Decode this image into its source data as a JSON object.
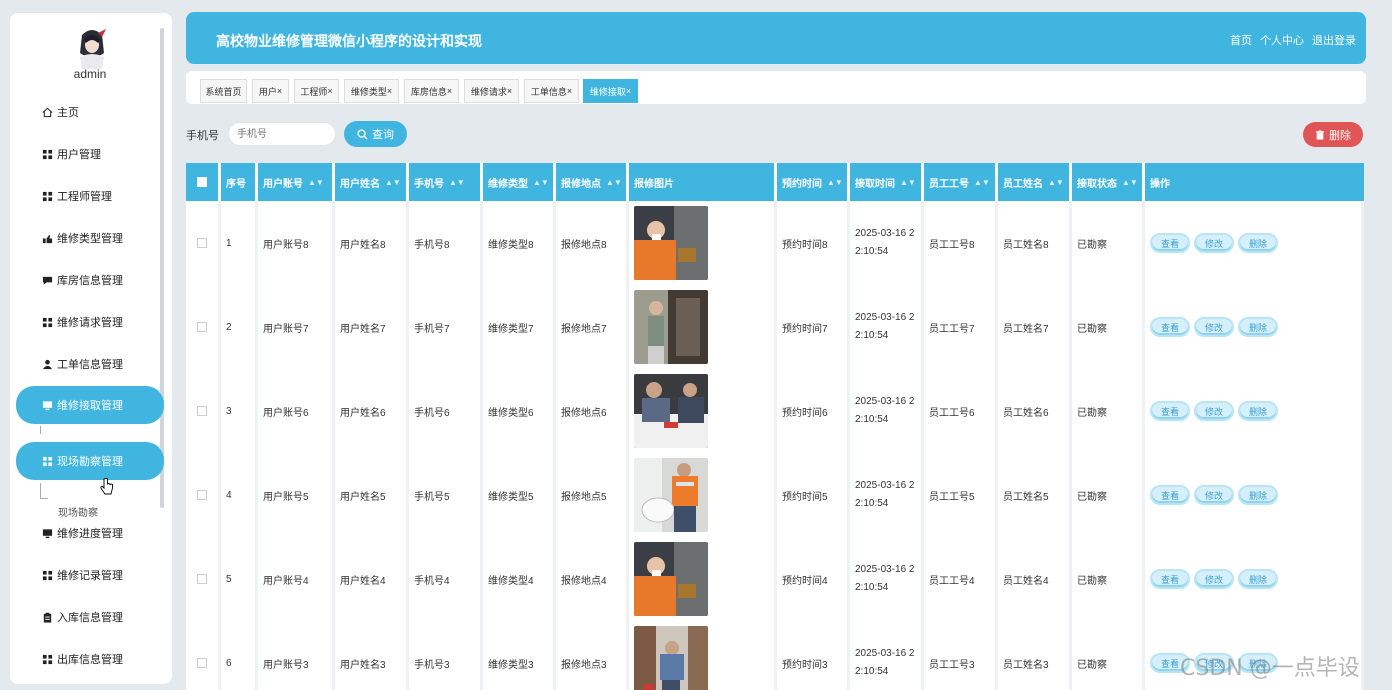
{
  "sidebar": {
    "username": "admin",
    "items": [
      {
        "label": "主页",
        "icon": "home-icon"
      },
      {
        "label": "用户管理",
        "icon": "grid-icon"
      },
      {
        "label": "工程师管理",
        "icon": "grid-icon"
      },
      {
        "label": "维修类型管理",
        "icon": "hand-icon"
      },
      {
        "label": "库房信息管理",
        "icon": "chat-icon"
      },
      {
        "label": "维修请求管理",
        "icon": "grid-icon"
      },
      {
        "label": "工单信息管理",
        "icon": "user-icon"
      },
      {
        "label": "维修接取管理",
        "icon": "monitor-icon"
      },
      {
        "label": "现场勘察管理",
        "icon": "grid-icon"
      },
      {
        "label": "维修进度管理",
        "icon": "monitor-icon"
      },
      {
        "label": "维修记录管理",
        "icon": "grid-icon"
      },
      {
        "label": "入库信息管理",
        "icon": "clipboard-icon"
      },
      {
        "label": "出库信息管理",
        "icon": "grid-icon"
      }
    ],
    "submenu_label": "现场勘察"
  },
  "header": {
    "title": "高校物业维修管理微信小程序的设计和实现",
    "links": [
      "首页",
      "个人中心",
      "退出登录"
    ]
  },
  "tabs": [
    "系统首页",
    "用户",
    "工程师",
    "维修类型",
    "库房信息",
    "维修请求",
    "工单信息",
    "维修接取"
  ],
  "search": {
    "label": "手机号",
    "placeholder": "手机号",
    "button": "查询",
    "delete_button": "删除"
  },
  "table": {
    "columns": [
      "序号",
      "用户账号",
      "用户姓名",
      "手机号",
      "维修类型",
      "报修地点",
      "报修图片",
      "预约时间",
      "接取时间",
      "员工工号",
      "员工姓名",
      "接取状态",
      "操作"
    ],
    "rows": [
      {
        "idx": "1",
        "account": "用户账号8",
        "name": "用户姓名8",
        "phone": "手机号8",
        "type": "维修类型8",
        "place": "报修地点8",
        "appt": "预约时间8",
        "time": "2025-03-16 2\n2:10:54",
        "emp_no": "员工工号8",
        "emp_name": "员工姓名8",
        "status": "已勘察"
      },
      {
        "idx": "2",
        "account": "用户账号7",
        "name": "用户姓名7",
        "phone": "手机号7",
        "type": "维修类型7",
        "place": "报修地点7",
        "appt": "预约时间7",
        "time": "2025-03-16 2\n2:10:54",
        "emp_no": "员工工号7",
        "emp_name": "员工姓名7",
        "status": "已勘察"
      },
      {
        "idx": "3",
        "account": "用户账号6",
        "name": "用户姓名6",
        "phone": "手机号6",
        "type": "维修类型6",
        "place": "报修地点6",
        "appt": "预约时间6",
        "time": "2025-03-16 2\n2:10:54",
        "emp_no": "员工工号6",
        "emp_name": "员工姓名6",
        "status": "已勘察"
      },
      {
        "idx": "4",
        "account": "用户账号5",
        "name": "用户姓名5",
        "phone": "手机号5",
        "type": "维修类型5",
        "place": "报修地点5",
        "appt": "预约时间5",
        "time": "2025-03-16 2\n2:10:54",
        "emp_no": "员工工号5",
        "emp_name": "员工姓名5",
        "status": "已勘察"
      },
      {
        "idx": "5",
        "account": "用户账号4",
        "name": "用户姓名4",
        "phone": "手机号4",
        "type": "维修类型4",
        "place": "报修地点4",
        "appt": "预约时间4",
        "time": "2025-03-16 2\n2:10:54",
        "emp_no": "员工工号4",
        "emp_name": "员工姓名4",
        "status": "已勘察"
      },
      {
        "idx": "6",
        "account": "用户账号3",
        "name": "用户姓名3",
        "phone": "手机号3",
        "type": "维修类型3",
        "place": "报修地点3",
        "appt": "预约时间3",
        "time": "2025-03-16 2\n2:10:54",
        "emp_no": "员工工号3",
        "emp_name": "员工姓名3",
        "status": "已勘察"
      }
    ],
    "actions": [
      "查看",
      "修改",
      "删除"
    ]
  },
  "watermark": "CSDN @一点毕设",
  "colors": {
    "accent": "#3fb5e0",
    "danger": "#e05555",
    "background": "#e3e9ed"
  }
}
